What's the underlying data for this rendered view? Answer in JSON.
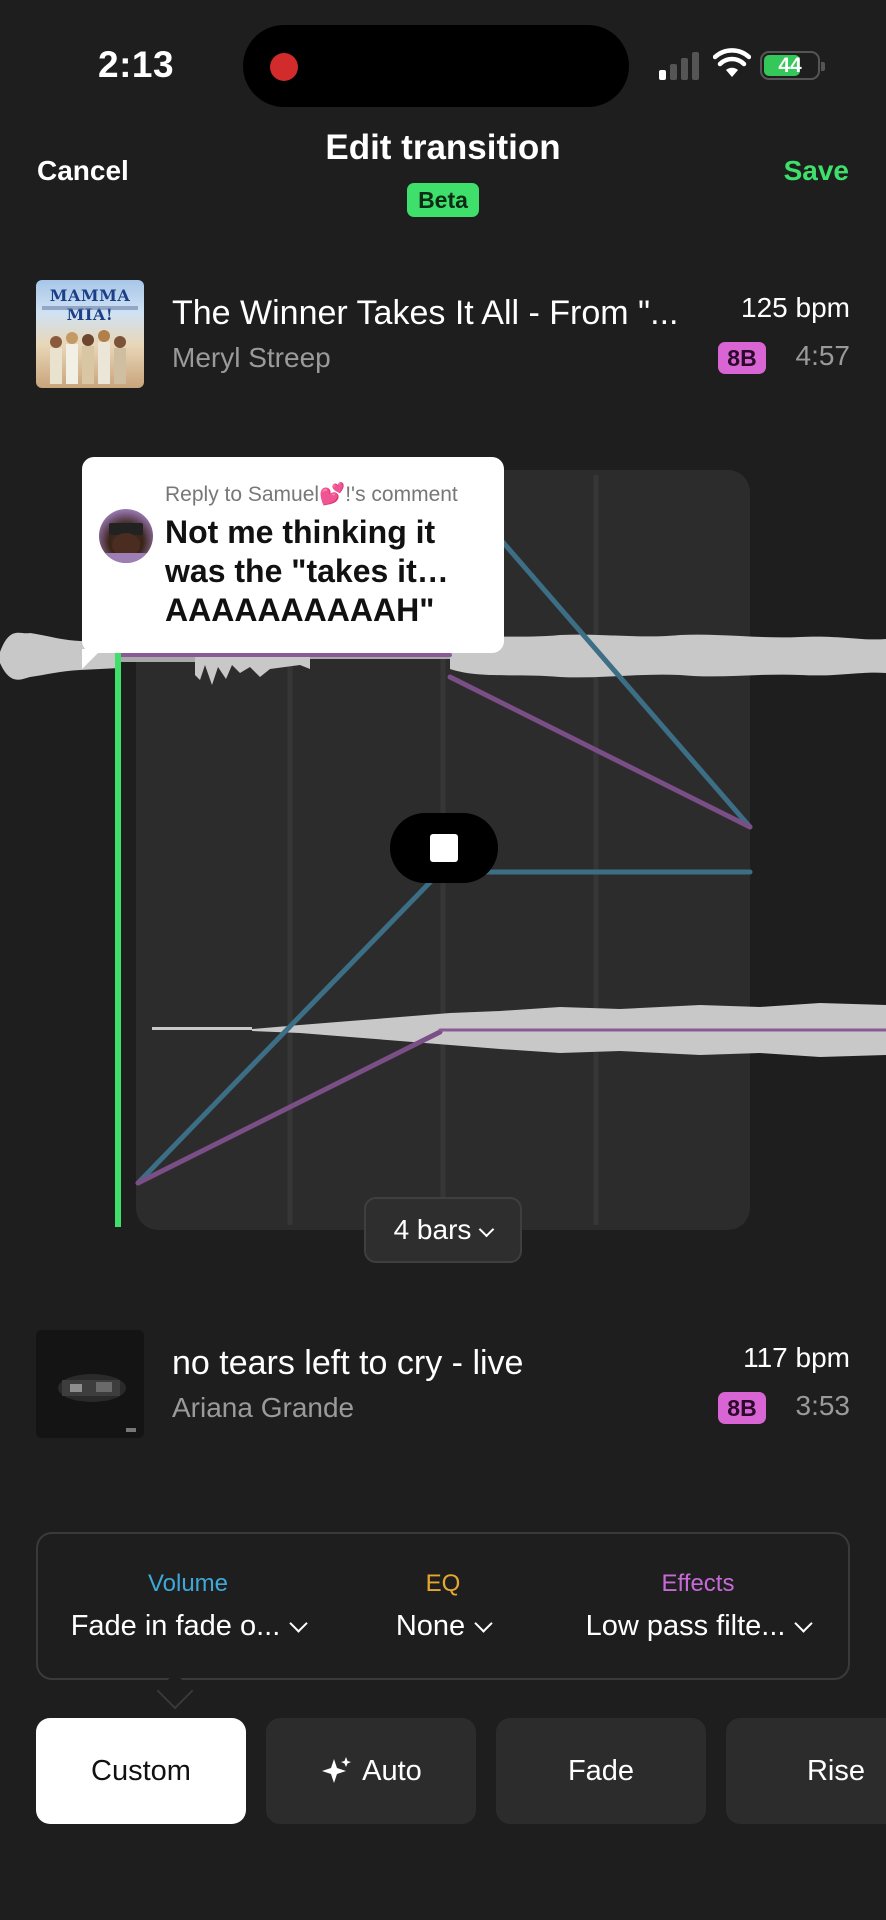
{
  "status_bar": {
    "time": "2:13",
    "battery": "44"
  },
  "header": {
    "cancel_label": "Cancel",
    "title": "Edit transition",
    "badge": "Beta",
    "save_label": "Save"
  },
  "track_from": {
    "title": "The Winner Takes It All - From \"...",
    "artist": "Meryl Streep",
    "bpm": "125 bpm",
    "key": "8B",
    "duration": "4:57",
    "art_text": "MAMMA MIA!"
  },
  "track_to": {
    "title": "no tears left to cry - live",
    "artist": "Ariana Grande",
    "bpm": "117 bpm",
    "key": "8B",
    "duration": "3:53"
  },
  "comment": {
    "reply_to": "Reply to Samuel💕!'s comment",
    "text": "Not me thinking it was the \"takes it… AAAAAAAAAAH\""
  },
  "editor": {
    "bars_label": "4 bars"
  },
  "controls": {
    "volume": {
      "label": "Volume",
      "value": "Fade in fade o...",
      "color": "#3fa8d8"
    },
    "eq": {
      "label": "EQ",
      "value": "None",
      "color": "#e6a72e"
    },
    "effects": {
      "label": "Effects",
      "value": "Low pass filte...",
      "color": "#c76ad8"
    }
  },
  "presets": [
    {
      "label": "Custom"
    },
    {
      "label": "Auto",
      "icon": "sparkle-icon"
    },
    {
      "label": "Fade"
    },
    {
      "label": "Rise"
    }
  ],
  "colors": {
    "accent_green": "#3ee06b",
    "key_badge": "#d965d4",
    "volume_line": "#3c6e86",
    "effects_line": "#7a4f86"
  }
}
